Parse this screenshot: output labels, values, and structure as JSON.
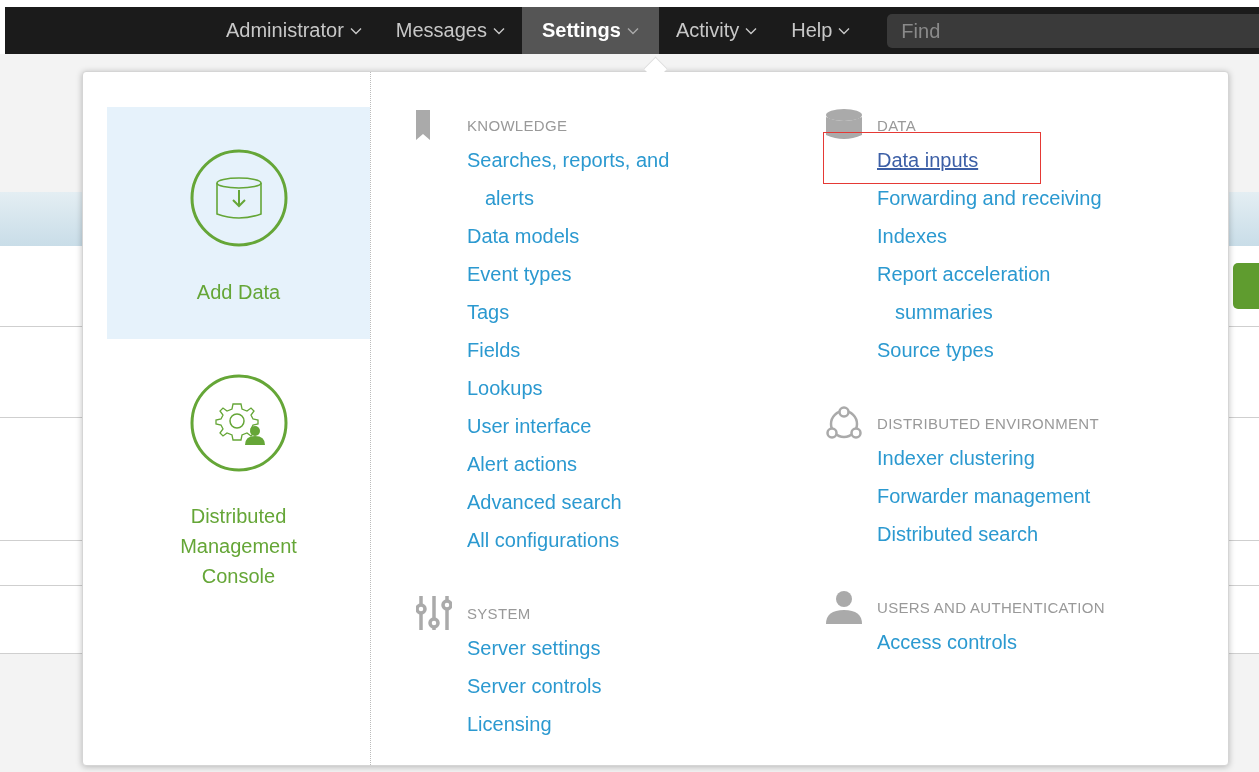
{
  "nav": {
    "items": [
      {
        "label": "Administrator",
        "selected": false
      },
      {
        "label": "Messages",
        "selected": false
      },
      {
        "label": "Settings",
        "selected": true
      },
      {
        "label": "Activity",
        "selected": false
      },
      {
        "label": "Help",
        "selected": false
      }
    ],
    "search": {
      "placeholder": "Find"
    }
  },
  "menu": {
    "tiles": [
      {
        "label": "Add Data",
        "kind": "add-data",
        "selected": true
      },
      {
        "label": "Distributed Management Console",
        "kind": "console",
        "selected": false
      }
    ],
    "columns": [
      {
        "sections": [
          {
            "title": "KNOWLEDGE",
            "kind": "bookmark",
            "links": [
              {
                "label": "Searches, reports, and alerts",
                "hovered": false,
                "highlighted": false
              },
              {
                "label": "Data models",
                "hovered": false,
                "highlighted": false
              },
              {
                "label": "Event types",
                "hovered": false,
                "highlighted": false
              },
              {
                "label": "Tags",
                "hovered": false,
                "highlighted": false
              },
              {
                "label": "Fields",
                "hovered": false,
                "highlighted": false
              },
              {
                "label": "Lookups",
                "hovered": false,
                "highlighted": false
              },
              {
                "label": "User interface",
                "hovered": false,
                "highlighted": false
              },
              {
                "label": "Alert actions",
                "hovered": false,
                "highlighted": false
              },
              {
                "label": "Advanced search",
                "hovered": false,
                "highlighted": false
              },
              {
                "label": "All configurations",
                "hovered": false,
                "highlighted": false
              }
            ]
          },
          {
            "title": "SYSTEM",
            "kind": "sliders",
            "links": [
              {
                "label": "Server settings",
                "hovered": false,
                "highlighted": false
              },
              {
                "label": "Server controls",
                "hovered": false,
                "highlighted": false
              },
              {
                "label": "Licensing",
                "hovered": false,
                "highlighted": false
              }
            ]
          }
        ]
      },
      {
        "sections": [
          {
            "title": "DATA",
            "kind": "database",
            "links": [
              {
                "label": "Data inputs",
                "hovered": true,
                "highlighted": true
              },
              {
                "label": "Forwarding and receiving",
                "hovered": false,
                "highlighted": false
              },
              {
                "label": "Indexes",
                "hovered": false,
                "highlighted": false
              },
              {
                "label": "Report acceleration summaries",
                "hovered": false,
                "highlighted": false
              },
              {
                "label": "Source types",
                "hovered": false,
                "highlighted": false
              }
            ]
          },
          {
            "title": "DISTRIBUTED ENVIRONMENT",
            "kind": "cluster",
            "links": [
              {
                "label": "Indexer clustering",
                "hovered": false,
                "highlighted": false
              },
              {
                "label": "Forwarder management",
                "hovered": false,
                "highlighted": false
              },
              {
                "label": "Distributed search",
                "hovered": false,
                "highlighted": false
              }
            ]
          },
          {
            "title": "USERS AND AUTHENTICATION",
            "kind": "user",
            "links": [
              {
                "label": "Access controls",
                "hovered": false,
                "highlighted": false
              }
            ]
          }
        ]
      }
    ]
  }
}
